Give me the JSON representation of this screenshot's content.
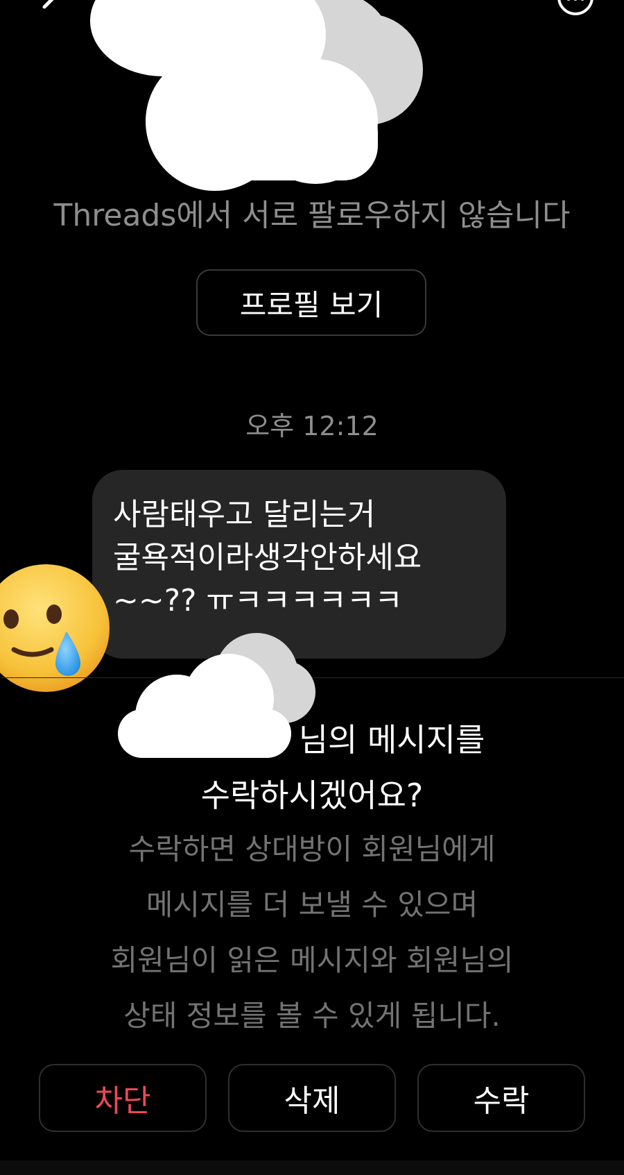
{
  "header": {
    "back_icon": "chevron-left-icon",
    "menu_icon": "more-options-icon"
  },
  "profile": {
    "follow_status": "Threads에서 서로 팔로우하지 않습니다",
    "view_profile_label": "프로필 보기"
  },
  "conversation": {
    "timestamp": "오후 12:12",
    "message_lines": [
      "사람태우고 달리는거",
      "굴욕적이라생각안하세요",
      "~~?? ㅠㅋㅋㅋㅋㅋㅋ"
    ],
    "emoji_icon": "smiling-face-with-tear-icon"
  },
  "request": {
    "title_line1_suffix": "님의 메시지를",
    "title_line2": "수락하시겠어요?",
    "description_lines": [
      "수락하면 상대방이 회원님에게",
      "메시지를 더 보낼 수 있으며",
      "회원님이 읽은 메시지와 회원님의",
      "상태 정보를 볼 수 있게 됩니다."
    ]
  },
  "actions": {
    "block_label": "차단",
    "delete_label": "삭제",
    "accept_label": "수락",
    "block_color": "#ed4956"
  }
}
